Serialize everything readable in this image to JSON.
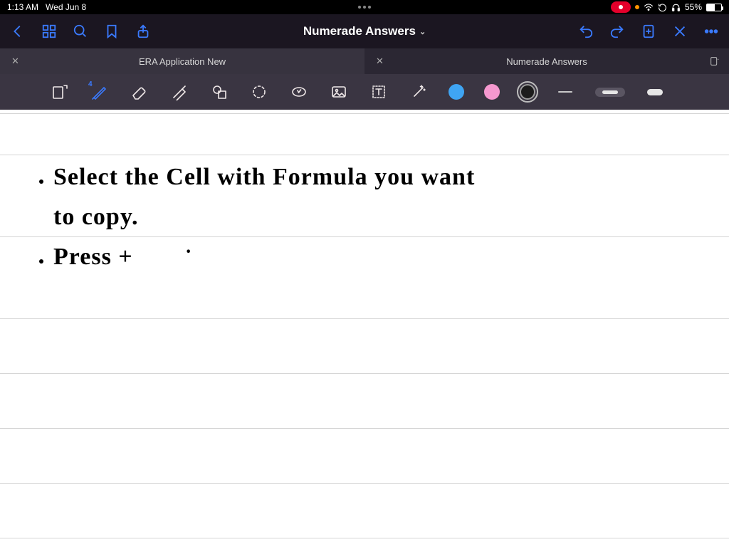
{
  "status": {
    "time": "1:13 AM",
    "date": "Wed Jun 8",
    "battery": "55%",
    "orange_dot": true
  },
  "app_header": {
    "title": "Numerade Answers"
  },
  "tabs": [
    {
      "label": "ERA Application New",
      "active": false
    },
    {
      "label": "Numerade Answers",
      "active": true
    }
  ],
  "toolbar": {
    "pen_index_label": "4",
    "colors": [
      "blue",
      "pink",
      "black"
    ],
    "selected_color": "black",
    "selected_stroke": "medium"
  },
  "notes": {
    "line1": "Select the Cell with Formula you want",
    "line2": "to copy.",
    "line3": "Press +"
  }
}
